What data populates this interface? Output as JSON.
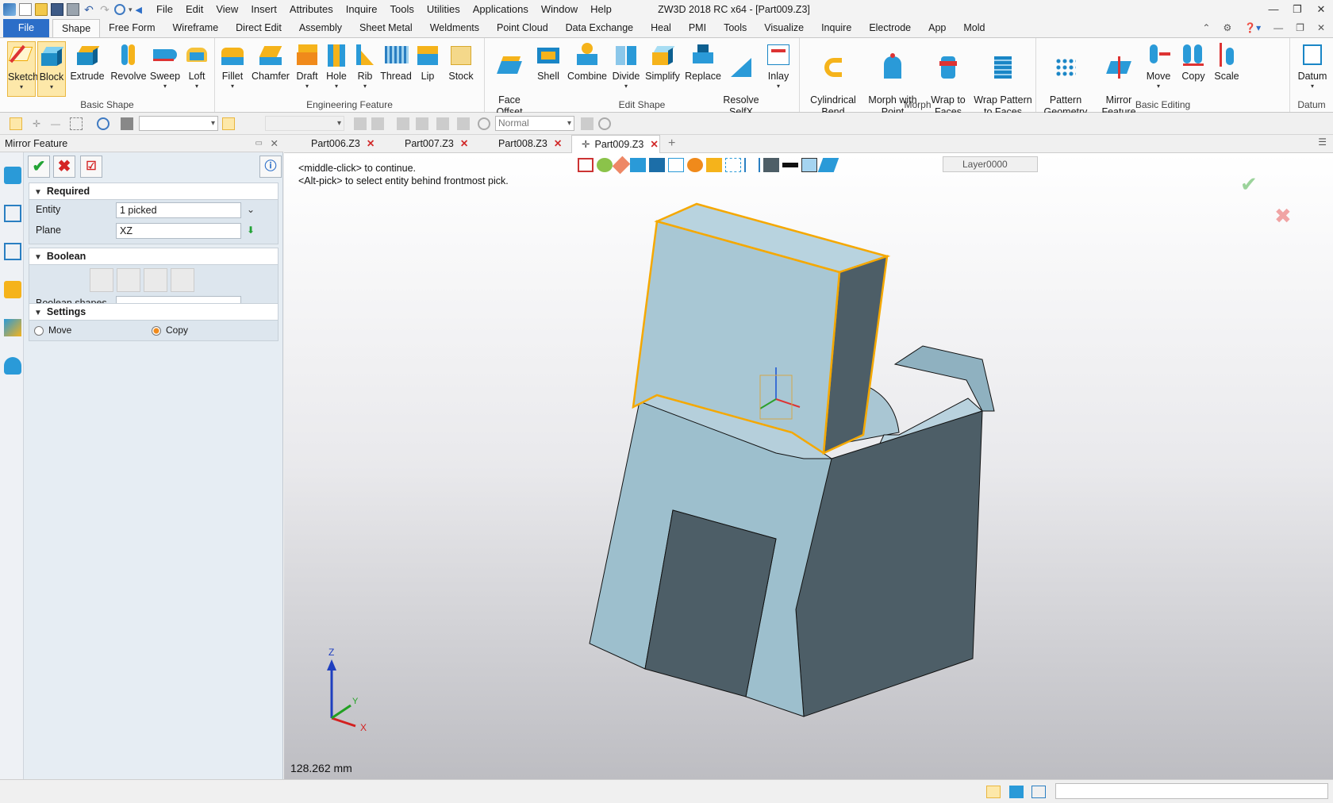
{
  "window": {
    "title": "ZW3D 2018 RC x64 - [Part009.Z3]",
    "menu": [
      "File",
      "Edit",
      "View",
      "Insert",
      "Attributes",
      "Inquire",
      "Tools",
      "Utilities",
      "Applications",
      "Window",
      "Help"
    ]
  },
  "ribbon_tabs": [
    "File",
    "Shape",
    "Free Form",
    "Wireframe",
    "Direct Edit",
    "Assembly",
    "Sheet Metal",
    "Weldments",
    "Point Cloud",
    "Data Exchange",
    "Heal",
    "PMI",
    "Tools",
    "Visualize",
    "Inquire",
    "Electrode",
    "App",
    "Mold"
  ],
  "active_ribbon_tab": "Shape",
  "ribbon_groups": {
    "basic_shape": {
      "title": "Basic Shape",
      "buttons": [
        "Sketch",
        "Block",
        "Extrude",
        "Revolve",
        "Sweep",
        "Loft"
      ]
    },
    "engineering_feature": {
      "title": "Engineering Feature",
      "buttons": [
        "Fillet",
        "Chamfer",
        "Draft",
        "Hole",
        "Rib",
        "Thread",
        "Lip",
        "Stock"
      ]
    },
    "edit_shape": {
      "title": "Edit Shape",
      "buttons": [
        "Face\nOffset",
        "Shell",
        "Combine",
        "Divide",
        "Simplify",
        "Replace",
        "Resolve\nSelfX",
        "Inlay"
      ]
    },
    "morph": {
      "title": "Morph",
      "buttons": [
        "Cylindrical\nBend",
        "Morph with\nPoint",
        "Wrap to\nFaces",
        "Wrap Pattern\nto Faces"
      ]
    },
    "basic_editing": {
      "title": "Basic Editing",
      "buttons": [
        "Pattern\nGeometry",
        "Mirror\nFeature",
        "Move",
        "Copy",
        "Scale"
      ]
    },
    "datum": {
      "title": "Datum",
      "buttons": [
        "Datum"
      ]
    }
  },
  "toolbar2": {
    "render_mode": "Normal"
  },
  "panel": {
    "title": "Mirror Feature",
    "required": {
      "title": "Required",
      "entity_label": "Entity",
      "entity_value": "1 picked",
      "plane_label": "Plane",
      "plane_value": "XZ"
    },
    "boolean": {
      "title": "Boolean",
      "shapes_label": "Boolean shapes",
      "shapes_value": ""
    },
    "settings": {
      "title": "Settings",
      "move_label": "Move",
      "copy_label": "Copy",
      "selected": "Copy"
    }
  },
  "doc_tabs": [
    "Part006.Z3",
    "Part007.Z3",
    "Part008.Z3",
    "Part009.Z3"
  ],
  "active_doc": "Part009.Z3",
  "viewport": {
    "hint_1": "<middle-click> to continue.",
    "hint_2": "<Alt-pick> to select entity behind frontmost pick.",
    "layer": "Layer0000",
    "measure": "128.262 mm",
    "axis_x": "X",
    "axis_y": "Y",
    "axis_z": "Z"
  },
  "colors": {
    "accent": "#2c6ec8",
    "model_face": "#9ec0cf",
    "model_shadow": "#4d5e67",
    "highlight_edge": "#f5a800"
  }
}
